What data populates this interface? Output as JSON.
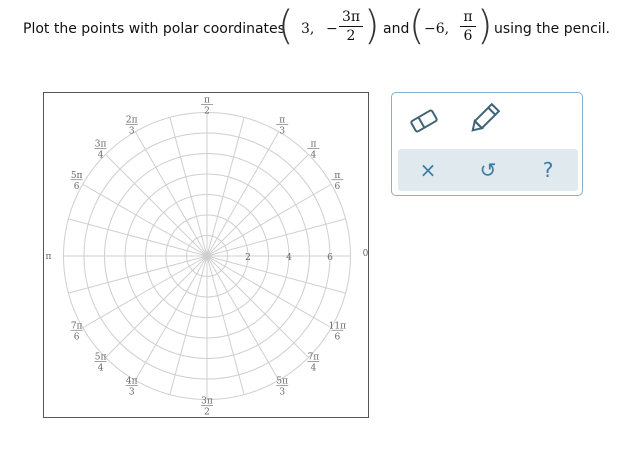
{
  "question": {
    "prefix": "Plot the points with polar coordinates",
    "p1_r": "3,",
    "p1_theta_sign": "−",
    "p1_theta_num": "3π",
    "p1_theta_den": "2",
    "conj": "and",
    "p2_r": "−6,",
    "p2_theta_num": "π",
    "p2_theta_den": "6",
    "suffix": "using the pencil."
  },
  "graph": {
    "radial_labels": [
      "2",
      "4",
      "6"
    ],
    "zero_label": "0",
    "pi_label": "π",
    "angle_fracs": [
      {
        "num": "π",
        "den": "6"
      },
      {
        "num": "π",
        "den": "4"
      },
      {
        "num": "π",
        "den": "3"
      },
      {
        "num": "π",
        "den": "2"
      },
      {
        "num": "2π",
        "den": "3"
      },
      {
        "num": "3π",
        "den": "4"
      },
      {
        "num": "5π",
        "den": "6"
      },
      {
        "num": "7π",
        "den": "6"
      },
      {
        "num": "5π",
        "den": "4"
      },
      {
        "num": "4π",
        "den": "3"
      },
      {
        "num": "3π",
        "den": "2"
      },
      {
        "num": "5π",
        "den": "3"
      },
      {
        "num": "7π",
        "den": "4"
      },
      {
        "num": "11π",
        "den": "6"
      }
    ]
  },
  "tools": {
    "eraser": "eraser-icon",
    "pencil": "pencil-icon",
    "clear": "×",
    "undo": "↺",
    "help": "?"
  },
  "colors": {
    "accent": "#3a7ca5",
    "panel": "#dfe9ee",
    "grid": "#cfcfcf"
  }
}
